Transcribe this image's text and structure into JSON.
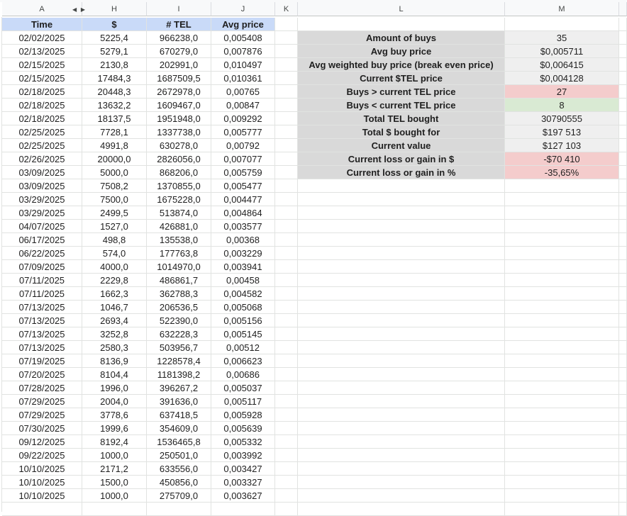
{
  "columns": {
    "A": "A",
    "H": "H",
    "I": "I",
    "J": "J",
    "K": "K",
    "L": "L",
    "M": "M"
  },
  "table": {
    "headers": [
      "Time",
      "$",
      "# TEL",
      "Avg price"
    ],
    "rows": [
      [
        "02/02/2025",
        "5225,4",
        "966238,0",
        "0,005408"
      ],
      [
        "02/13/2025",
        "5279,1",
        "670279,0",
        "0,007876"
      ],
      [
        "02/15/2025",
        "2130,8",
        "202991,0",
        "0,010497"
      ],
      [
        "02/15/2025",
        "17484,3",
        "1687509,5",
        "0,010361"
      ],
      [
        "02/18/2025",
        "20448,3",
        "2672978,0",
        "0,00765"
      ],
      [
        "02/18/2025",
        "13632,2",
        "1609467,0",
        "0,00847"
      ],
      [
        "02/18/2025",
        "18137,5",
        "1951948,0",
        "0,009292"
      ],
      [
        "02/25/2025",
        "7728,1",
        "1337738,0",
        "0,005777"
      ],
      [
        "02/25/2025",
        "4991,8",
        "630278,0",
        "0,00792"
      ],
      [
        "02/26/2025",
        "20000,0",
        "2826056,0",
        "0,007077"
      ],
      [
        "03/09/2025",
        "5000,0",
        "868206,0",
        "0,005759"
      ],
      [
        "03/09/2025",
        "7508,2",
        "1370855,0",
        "0,005477"
      ],
      [
        "03/29/2025",
        "7500,0",
        "1675228,0",
        "0,004477"
      ],
      [
        "03/29/2025",
        "2499,5",
        "513874,0",
        "0,004864"
      ],
      [
        "04/07/2025",
        "1527,0",
        "426881,0",
        "0,003577"
      ],
      [
        "06/17/2025",
        "498,8",
        "135538,0",
        "0,00368"
      ],
      [
        "06/22/2025",
        "574,0",
        "177763,8",
        "0,003229"
      ],
      [
        "07/09/2025",
        "4000,0",
        "1014970,0",
        "0,003941"
      ],
      [
        "07/11/2025",
        "2229,8",
        "486861,7",
        "0,00458"
      ],
      [
        "07/11/2025",
        "1662,3",
        "362788,3",
        "0,004582"
      ],
      [
        "07/13/2025",
        "1046,7",
        "206536,5",
        "0,005068"
      ],
      [
        "07/13/2025",
        "2693,4",
        "522390,0",
        "0,005156"
      ],
      [
        "07/13/2025",
        "3252,8",
        "632228,3",
        "0,005145"
      ],
      [
        "07/13/2025",
        "2580,3",
        "503956,7",
        "0,00512"
      ],
      [
        "07/19/2025",
        "8136,9",
        "1228578,4",
        "0,006623"
      ],
      [
        "07/20/2025",
        "8104,4",
        "1181398,2",
        "0,00686"
      ],
      [
        "07/28/2025",
        "1996,0",
        "396267,2",
        "0,005037"
      ],
      [
        "07/29/2025",
        "2004,0",
        "391636,0",
        "0,005117"
      ],
      [
        "07/29/2025",
        "3778,6",
        "637418,5",
        "0,005928"
      ],
      [
        "07/30/2025",
        "1999,6",
        "354609,0",
        "0,005639"
      ],
      [
        "09/12/2025",
        "8192,4",
        "1536465,8",
        "0,005332"
      ],
      [
        "09/22/2025",
        "1000,0",
        "250501,0",
        "0,003992"
      ],
      [
        "10/10/2025",
        "2171,2",
        "633556,0",
        "0,003427"
      ],
      [
        "10/10/2025",
        "1500,0",
        "450856,0",
        "0,003327"
      ],
      [
        "10/10/2025",
        "1000,0",
        "275709,0",
        "0,003627"
      ]
    ]
  },
  "summary": [
    {
      "label": "Amount of buys",
      "value": "35",
      "status": "neutral"
    },
    {
      "label": "Avg buy price",
      "value": "$0,005711",
      "status": "neutral"
    },
    {
      "label": "Avg weighted buy price (break even price)",
      "value": "$0,006415",
      "status": "neutral"
    },
    {
      "label": "Current $TEL price",
      "value": "$0,004128",
      "status": "neutral"
    },
    {
      "label": "Buys > current TEL price",
      "value": "27",
      "status": "red"
    },
    {
      "label": "Buys < current TEL price",
      "value": "8",
      "status": "green"
    },
    {
      "label": "Total TEL bought",
      "value": "30790555",
      "status": "neutral"
    },
    {
      "label": "Total $ bought for",
      "value": "$197 513",
      "status": "neutral"
    },
    {
      "label": "Current value",
      "value": "$127 103",
      "status": "neutral"
    },
    {
      "label": "Current loss or gain in $",
      "value": "-$70 410",
      "status": "red"
    },
    {
      "label": "Current loss or gain in %",
      "value": "-35,65%",
      "status": "red"
    }
  ],
  "colors": {
    "header_blue": "#c9daf8",
    "label_gray": "#d9d9d9",
    "value_gray": "#efefef",
    "loss_red": "#f4cccc",
    "gain_green": "#d9ead3"
  },
  "icons": [
    "collapse-left-icon",
    "expand-right-icon"
  ]
}
